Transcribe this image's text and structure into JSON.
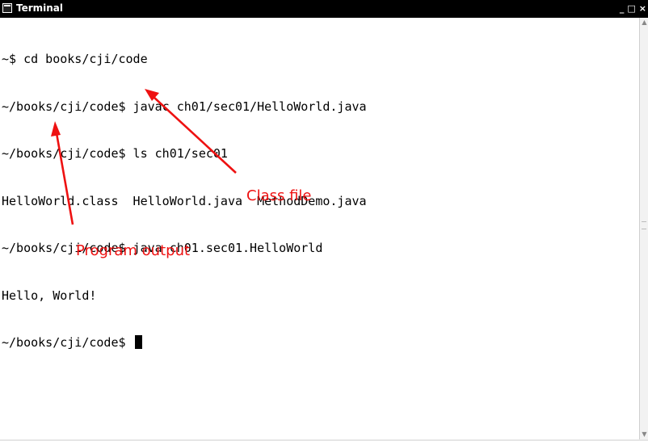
{
  "window": {
    "title": "Terminal",
    "controls": {
      "minimize": "_",
      "maximize": "□",
      "close": "×"
    }
  },
  "terminal": {
    "lines": [
      "~$ cd books/cji/code",
      "~/books/cji/code$ javac ch01/sec01/HelloWorld.java",
      "~/books/cji/code$ ls ch01/sec01",
      "HelloWorld.class  HelloWorld.java  MethodDemo.java",
      "~/books/cji/code$ java ch01.sec01.HelloWorld",
      "Hello, World!"
    ],
    "prompt": "~/books/cji/code$ "
  },
  "annotations": {
    "class_file": "Class file",
    "program_output": "Program output",
    "color": "#ee1111"
  },
  "icons": {
    "window_icon": "terminal-icon",
    "scroll_up": "scroll-up-arrow-icon",
    "scroll_down": "scroll-down-arrow-icon"
  }
}
